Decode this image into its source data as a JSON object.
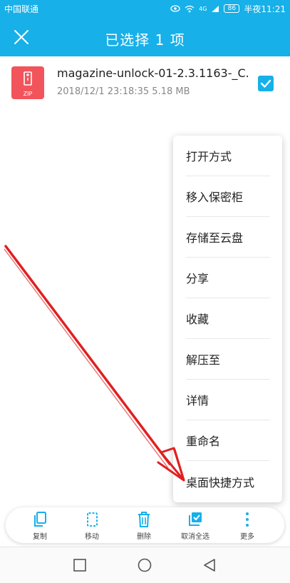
{
  "status_bar": {
    "carrier": "中国联通",
    "network": "4G",
    "battery": "86",
    "time": "半夜11:21"
  },
  "app_bar": {
    "title": "已选择 1 项",
    "close_icon": "close-icon"
  },
  "file": {
    "name": "magazine-unlock-01-2.3.1163-_C...",
    "meta": "2018/12/1 23:18:35 5.18 MB",
    "type_label": "ZIP",
    "selected": true
  },
  "menu": {
    "items": [
      {
        "label": "打开方式"
      },
      {
        "label": "移入保密柜"
      },
      {
        "label": "存储至云盘"
      },
      {
        "label": "分享"
      },
      {
        "label": "收藏"
      },
      {
        "label": "解压至"
      },
      {
        "label": "详情"
      },
      {
        "label": "重命名"
      },
      {
        "label": "桌面快捷方式"
      }
    ]
  },
  "toolbar": {
    "copy_label": "复制",
    "move_label": "移动",
    "delete_label": "删除",
    "deselect_label": "取消全选",
    "more_label": "更多"
  },
  "colors": {
    "accent": "#17b0e8",
    "zip_icon": "#f2545b",
    "arrow": "#e02020"
  }
}
